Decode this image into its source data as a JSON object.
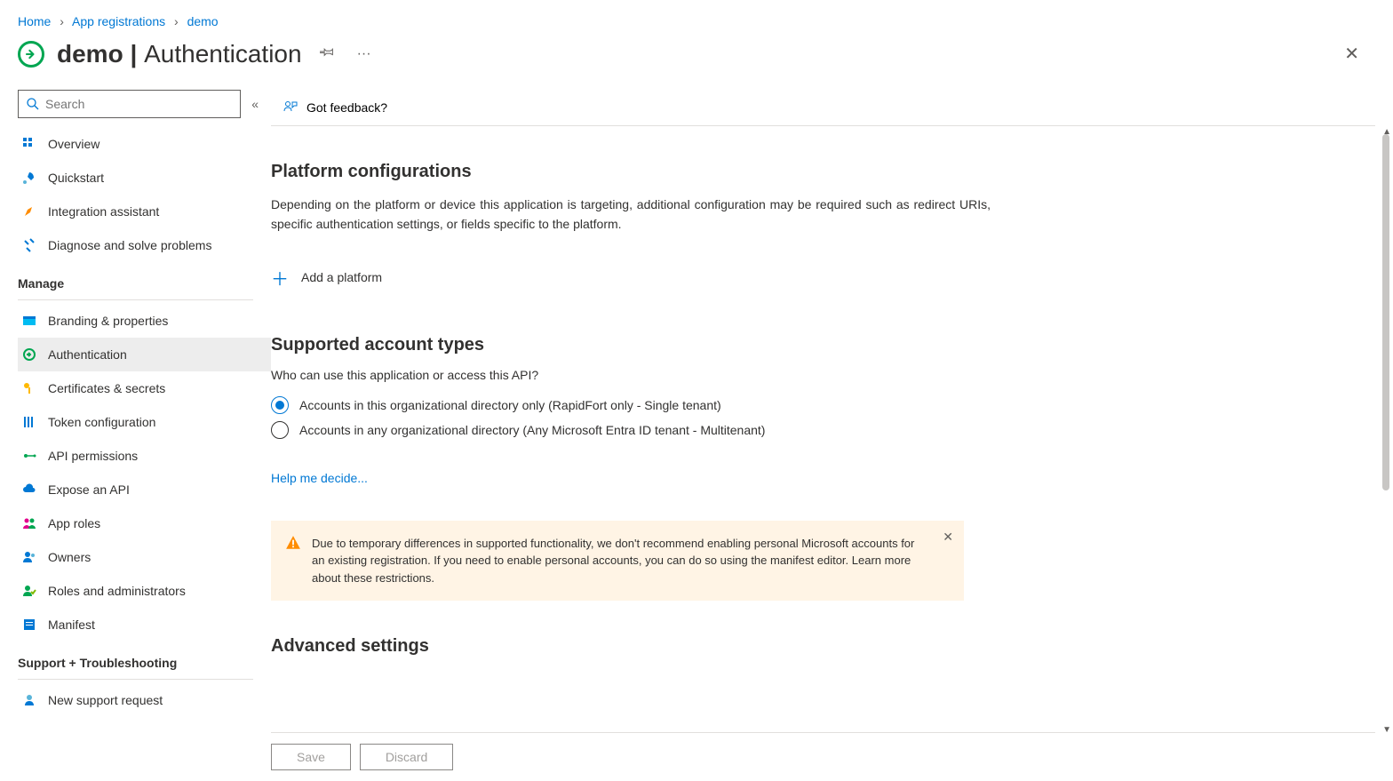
{
  "breadcrumb": {
    "home": "Home",
    "apps": "App registrations",
    "current": "demo"
  },
  "header": {
    "title": "demo",
    "subtitle": "Authentication"
  },
  "search": {
    "placeholder": "Search"
  },
  "cmdbar": {
    "feedback": "Got feedback?"
  },
  "nav": {
    "top": [
      {
        "label": "Overview"
      },
      {
        "label": "Quickstart"
      },
      {
        "label": "Integration assistant"
      },
      {
        "label": "Diagnose and solve problems"
      }
    ],
    "manage_header": "Manage",
    "manage": [
      {
        "label": "Branding & properties"
      },
      {
        "label": "Authentication"
      },
      {
        "label": "Certificates & secrets"
      },
      {
        "label": "Token configuration"
      },
      {
        "label": "API permissions"
      },
      {
        "label": "Expose an API"
      },
      {
        "label": "App roles"
      },
      {
        "label": "Owners"
      },
      {
        "label": "Roles and administrators"
      },
      {
        "label": "Manifest"
      }
    ],
    "support_header": "Support + Troubleshooting",
    "support": [
      {
        "label": "New support request"
      }
    ]
  },
  "platform": {
    "heading": "Platform configurations",
    "desc": "Depending on the platform or device this application is targeting, additional configuration may be required such as redirect URIs, specific authentication settings, or fields specific to the platform.",
    "add": "Add a platform"
  },
  "account": {
    "heading": "Supported account types",
    "question": "Who can use this application or access this API?",
    "opt1": "Accounts in this organizational directory only (RapidFort only - Single tenant)",
    "opt2": "Accounts in any organizational directory (Any Microsoft Entra ID tenant - Multitenant)",
    "help": "Help me decide..."
  },
  "alert": {
    "text": "Due to temporary differences in supported functionality, we don't recommend enabling personal Microsoft accounts for an existing registration. If you need to enable personal accounts, you can do so using the manifest editor. ",
    "link": "Learn more about these restrictions."
  },
  "advanced": {
    "heading": "Advanced settings"
  },
  "footer": {
    "save": "Save",
    "discard": "Discard"
  }
}
